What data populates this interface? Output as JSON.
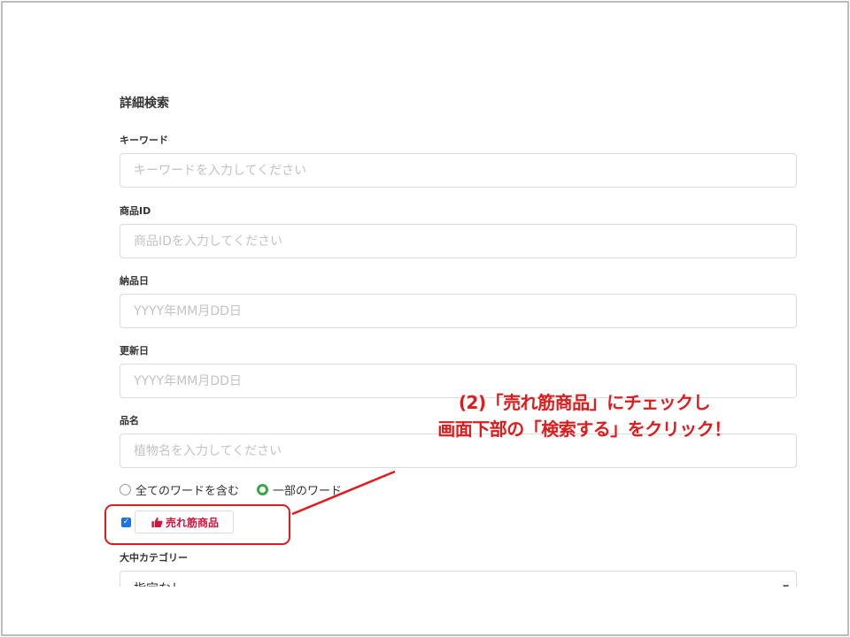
{
  "search": {
    "title": "詳細検索",
    "keyword": {
      "label": "キーワード",
      "placeholder": "キーワードを入力してください"
    },
    "product_id": {
      "label": "商品ID",
      "placeholder": "商品IDを入力してください"
    },
    "delivery_date": {
      "label": "納品日",
      "placeholder": "YYYY年MM月DD日"
    },
    "updated_date": {
      "label": "更新日",
      "placeholder": "YYYY年MM月DD日"
    },
    "product_name": {
      "label": "品名",
      "placeholder": "植物名を入力してください"
    },
    "match_options": {
      "all": "全てのワードを含む",
      "partial": "一部のワード",
      "selected": "partial"
    },
    "bestseller": {
      "label": "売れ筋商品",
      "checked": true
    },
    "category": {
      "label": "大中カテゴリー",
      "value": "指定なし"
    }
  },
  "annotation": {
    "line1": "(2)「売れ筋商品」にチェックし",
    "line2": "画面下部の「検索する」をクリック！",
    "color": "#e11b1b"
  },
  "colors": {
    "radio_selected": "#3aa648",
    "checkbox": "#1a73e8",
    "tag_text": "#d0143a"
  },
  "icons": {
    "bestseller": "thumbs-up-icon",
    "checkbox": "check-icon",
    "select": "chevron-down-icon"
  }
}
